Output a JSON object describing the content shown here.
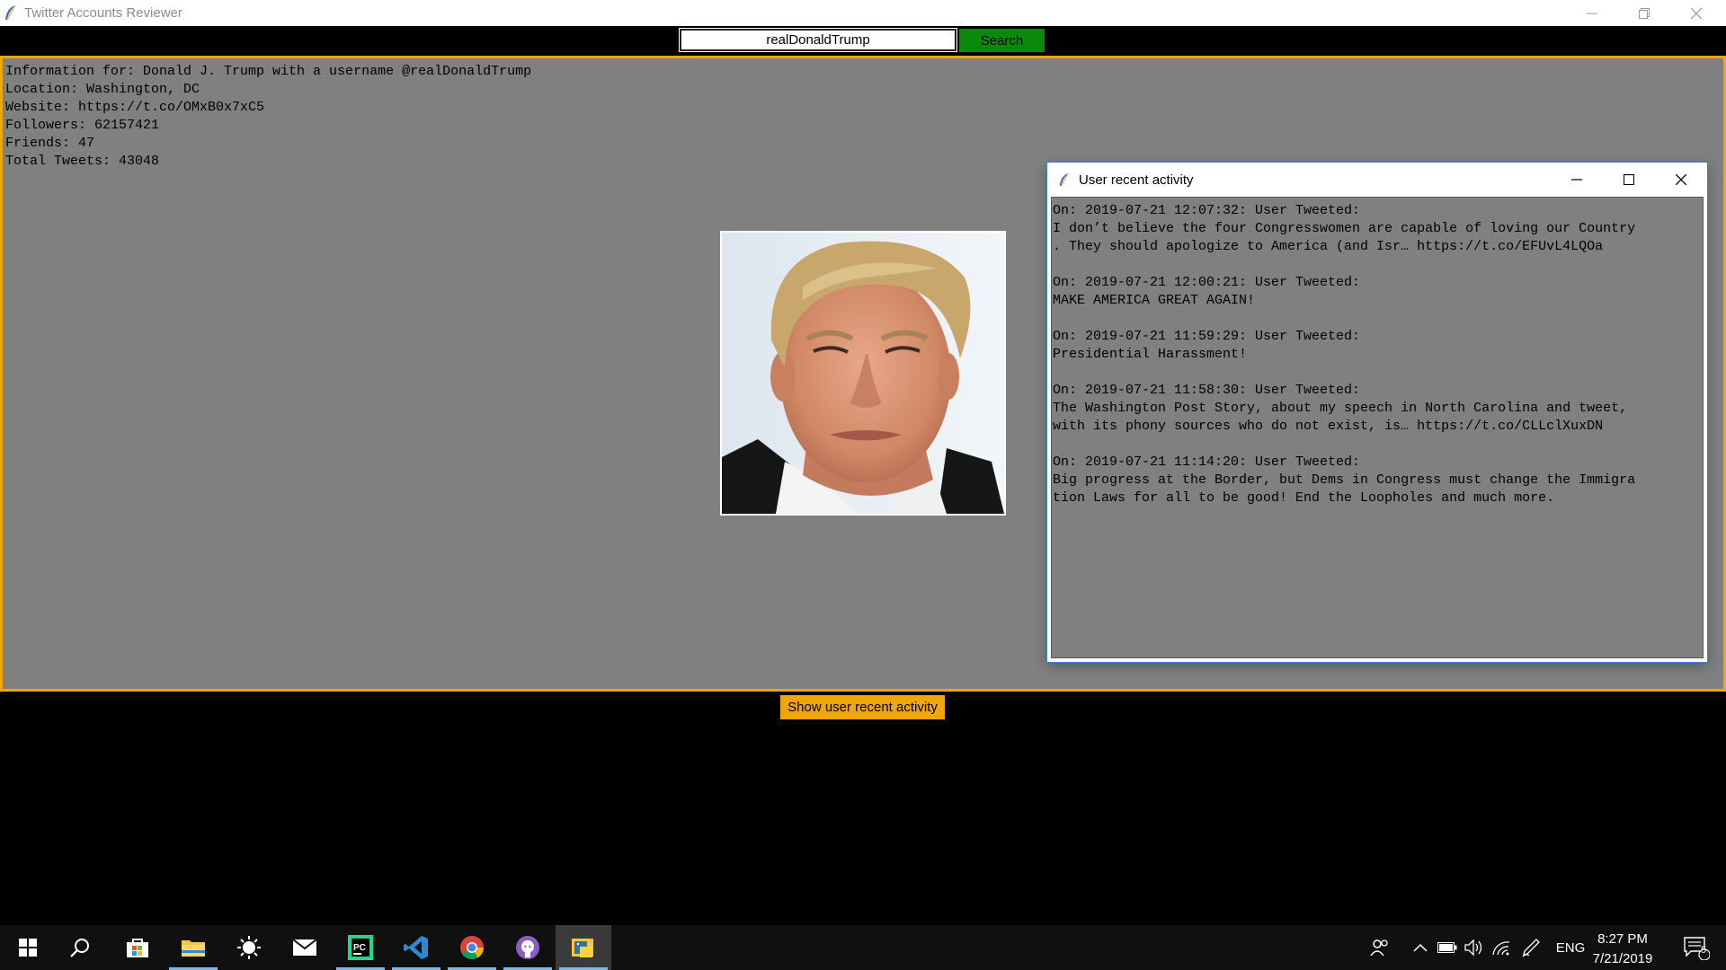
{
  "window": {
    "title": "Twitter Accounts Reviewer"
  },
  "search": {
    "value": "realDonaldTrump",
    "button_label": "Search"
  },
  "info": {
    "lines": [
      "Information for: Donald J. Trump with a username @realDonaldTrump",
      "Location: Washington, DC",
      "Website: https://t.co/OMxB0x7xC5",
      "Followers: 62157421",
      "Friends: 47",
      "Total Tweets: 43048"
    ]
  },
  "activity_window": {
    "title": "User recent activity",
    "lines": [
      "On: 2019-07-21 12:07:32: User Tweeted:",
      "I don’t believe the four Congresswomen are capable of loving our Country",
      ". They should apologize to America (and Isr… https://t.co/EFUvL4LQOa",
      "",
      "On: 2019-07-21 12:00:21: User Tweeted:",
      "MAKE AMERICA GREAT AGAIN!",
      "",
      "On: 2019-07-21 11:59:29: User Tweeted:",
      "Presidential Harassment!",
      "",
      "On: 2019-07-21 11:58:30: User Tweeted:",
      "The Washington Post Story, about my speech in North Carolina and tweet,",
      "with its phony sources who do not exist, is… https://t.co/CLLclXuxDN",
      "",
      "On: 2019-07-21 11:14:20: User Tweeted:",
      "Big progress at the Border, but Dems in Congress must change the Immigra",
      "tion Laws for all to be good! End the Loopholes and much more."
    ]
  },
  "actions": {
    "show_activity_label": "Show user recent activity"
  },
  "taskbar": {
    "apps": [
      "start-icon",
      "search-icon",
      "store-icon",
      "file-explorer-icon",
      "brightness-icon",
      "mail-icon",
      "pycharm-icon",
      "vscode-icon",
      "chrome-icon",
      "github-desktop-icon",
      "python-app-icon"
    ],
    "language": "ENG",
    "time": "8:27 PM",
    "date": "7/21/2019",
    "notification_count": "5"
  },
  "colors": {
    "panel_bg": "#808080",
    "panel_border": "#f0a50a",
    "search_button": "#0a8a0a",
    "activity_button": "#f0a50a"
  }
}
